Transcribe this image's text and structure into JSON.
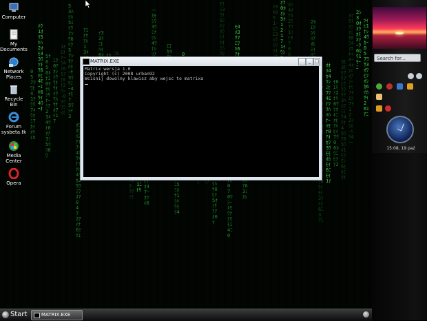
{
  "desktop": {
    "icons": [
      {
        "label": "Computer",
        "icon": "computer-icon"
      },
      {
        "label": "My Documents",
        "icon": "documents-icon"
      },
      {
        "label": "Network Places",
        "icon": "network-icon"
      },
      {
        "label": "Recycle Bin",
        "icon": "recycle-bin-icon"
      },
      {
        "label": "Forum sysbeta.tk",
        "icon": "internet-explorer-icon"
      },
      {
        "label": "Media Center",
        "icon": "media-center-icon"
      },
      {
        "label": "Opera",
        "icon": "opera-icon"
      }
    ],
    "rain_color": "#1f8a2a"
  },
  "window": {
    "title": "MATRIX.EXE",
    "minimize": "_",
    "maximize": "□",
    "close": "✕",
    "console_lines": [
      "Matrix wersja 1.0",
      "Copyright (c) 2008 urban92",
      "Wcisnij dowolny klawisz aby wejsc to matrixa"
    ]
  },
  "taskbar": {
    "start_label": "Start",
    "task_label": "MATRIX.EXE"
  },
  "sidebar": {
    "search_placeholder": "Search for...",
    "clock_label": "15:08, 19 paź"
  }
}
